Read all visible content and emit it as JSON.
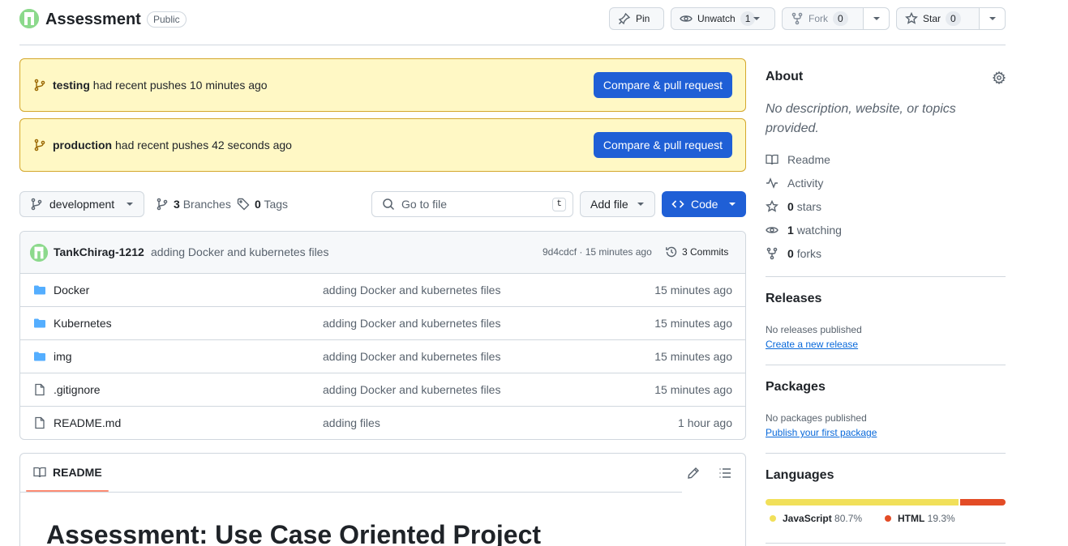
{
  "repo": {
    "name": "Assessment",
    "visibility": "Public"
  },
  "actions": {
    "pin": "Pin",
    "unwatch": "Unwatch",
    "watch_count": "1",
    "fork": "Fork",
    "fork_count": "0",
    "star": "Star",
    "star_count": "0"
  },
  "banners": [
    {
      "branch": "testing",
      "text": "had recent pushes 10 minutes ago",
      "button": "Compare & pull request"
    },
    {
      "branch": "production",
      "text": "had recent pushes 42 seconds ago",
      "button": "Compare & pull request"
    }
  ],
  "toolbar": {
    "branch": "development",
    "branches_count": "3",
    "branches_label": "Branches",
    "tags_count": "0",
    "tags_label": "Tags",
    "search_placeholder": "Go to file",
    "search_shortcut": "t",
    "add_file": "Add file",
    "code": "Code"
  },
  "latest_commit": {
    "author": "TankChirag-1212",
    "message": "adding Docker and kubernetes files",
    "meta": "9d4cdcf · 15 minutes ago",
    "commits": "3 Commits"
  },
  "files": [
    {
      "type": "folder",
      "name": "Docker",
      "message": "adding Docker and kubernetes files",
      "date": "15 minutes ago"
    },
    {
      "type": "folder",
      "name": "Kubernetes",
      "message": "adding Docker and kubernetes files",
      "date": "15 minutes ago"
    },
    {
      "type": "folder",
      "name": "img",
      "message": "adding Docker and kubernetes files",
      "date": "15 minutes ago"
    },
    {
      "type": "file",
      "name": ".gitignore",
      "message": "adding Docker and kubernetes files",
      "date": "15 minutes ago"
    },
    {
      "type": "file",
      "name": "README.md",
      "message": "adding files",
      "date": "1 hour ago"
    }
  ],
  "readme": {
    "tab": "README",
    "title": "Assessment: Use Case Oriented Project"
  },
  "about": {
    "heading": "About",
    "description": "No description, website, or topics provided.",
    "readme": "Readme",
    "activity": "Activity",
    "stars_count": "0",
    "stars_label": "stars",
    "watching_count": "1",
    "watching_label": "watching",
    "forks_count": "0",
    "forks_label": "forks"
  },
  "releases": {
    "heading": "Releases",
    "empty": "No releases published",
    "link": "Create a new release"
  },
  "packages": {
    "heading": "Packages",
    "empty": "No packages published",
    "link": "Publish your first package"
  },
  "languages": {
    "heading": "Languages",
    "items": [
      {
        "name": "JavaScript",
        "percent": "80.7%",
        "share": 80.7,
        "color": "#f1e05a"
      },
      {
        "name": "HTML",
        "percent": "19.3%",
        "share": 19.3,
        "color": "#e34c26"
      }
    ]
  },
  "colors": {
    "primary": "#1f5fd6",
    "banner_bg": "#fff8c5",
    "banner_border": "#d4a72c",
    "link": "#0969da"
  }
}
